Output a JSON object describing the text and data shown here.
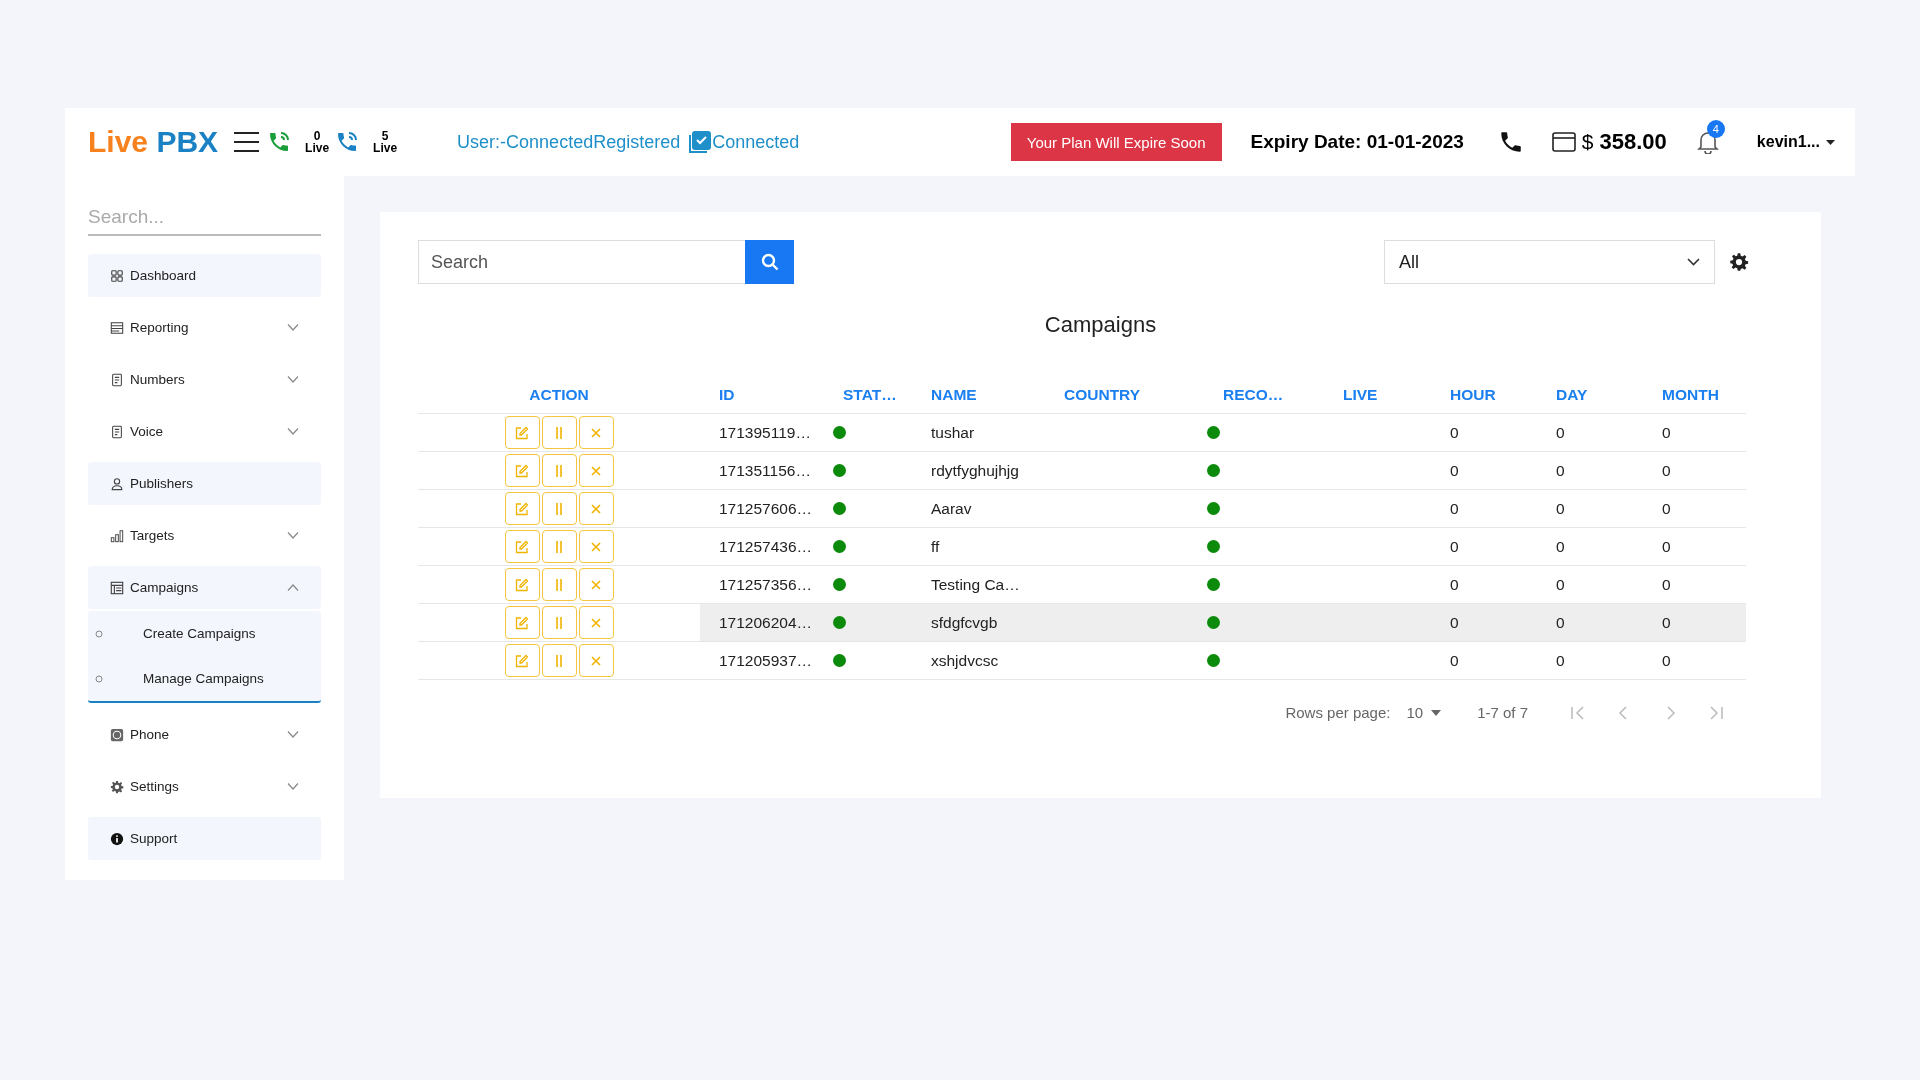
{
  "header": {
    "logo": {
      "part_1": "Live",
      "part_2": "PBX"
    },
    "live_counters": [
      {
        "count": "0",
        "label": "Live",
        "color": "#1a9e3a"
      },
      {
        "count": "5",
        "label": "Live",
        "color": "#1a82c4"
      }
    ],
    "user_status": "User:-ConnectedRegistered",
    "connection": {
      "checked": true,
      "label": "Connected"
    },
    "plan_alert": "Your Plan Will Expire Soon",
    "expiry": "Expiry Date: 01-01-2023",
    "balance": {
      "currency": "$",
      "amount": "358.00"
    },
    "notifications": "4",
    "user": "kevin1..."
  },
  "sidebar": {
    "search": {
      "placeholder": "Search..."
    },
    "items": [
      {
        "label": "Dashboard",
        "kind": "link"
      },
      {
        "label": "Reporting",
        "kind": "group",
        "expanded": false
      },
      {
        "label": "Numbers",
        "kind": "group",
        "expanded": false
      },
      {
        "label": "Voice",
        "kind": "group",
        "expanded": false
      },
      {
        "label": "Publishers",
        "kind": "link"
      },
      {
        "label": "Targets",
        "kind": "group",
        "expanded": false
      },
      {
        "label": "Campaigns",
        "kind": "group",
        "expanded": true,
        "children": [
          {
            "label": "Create Campaigns"
          },
          {
            "label": "Manage Campaigns"
          }
        ]
      },
      {
        "label": "Phone",
        "kind": "group",
        "expanded": false
      },
      {
        "label": "Settings",
        "kind": "group",
        "expanded": false
      },
      {
        "label": "Support",
        "kind": "link"
      }
    ]
  },
  "main": {
    "search": {
      "placeholder": "Search"
    },
    "filter": "All",
    "title": "Campaigns",
    "table": {
      "columns": [
        "ACTION",
        "ID",
        "STAT…",
        "NAME",
        "COUNTRY",
        "RECO…",
        "LIVE",
        "HOUR",
        "DAY",
        "MONTH"
      ],
      "rows": [
        {
          "id": "171395119…",
          "status": {
            "color": "#0b8a0b"
          },
          "name": "tushar",
          "recording": {
            "color": "#0b8a0b"
          },
          "hour": "0",
          "day": "0",
          "month": "0",
          "selected": false
        },
        {
          "id": "171351156…",
          "status": {
            "color": "#0b8a0b"
          },
          "name": "rdytfyghujhjg",
          "recording": {
            "color": "#0b8a0b"
          },
          "hour": "0",
          "day": "0",
          "month": "0",
          "selected": false
        },
        {
          "id": "171257606…",
          "status": {
            "color": "#0b8a0b"
          },
          "name": "Aarav",
          "recording": {
            "color": "#0b8a0b"
          },
          "hour": "0",
          "day": "0",
          "month": "0",
          "selected": false
        },
        {
          "id": "171257436…",
          "status": {
            "color": "#0b8a0b"
          },
          "name": "ff",
          "recording": {
            "color": "#0b8a0b"
          },
          "hour": "0",
          "day": "0",
          "month": "0",
          "selected": false
        },
        {
          "id": "171257356…",
          "status": {
            "color": "#0b8a0b"
          },
          "name": "Testing Ca…",
          "recording": {
            "color": "#0b8a0b"
          },
          "hour": "0",
          "day": "0",
          "month": "0",
          "selected": false
        },
        {
          "id": "171206204…",
          "status": {
            "color": "#0b8a0b"
          },
          "name": "sfdgfcvgb",
          "recording": {
            "color": "#0b8a0b"
          },
          "hour": "0",
          "day": "0",
          "month": "0",
          "selected": true
        },
        {
          "id": "171205937…",
          "status": {
            "color": "#0b8a0b"
          },
          "name": "xshjdvcsc",
          "recording": {
            "color": "#0b8a0b"
          },
          "hour": "0",
          "day": "0",
          "month": "0",
          "selected": false
        }
      ]
    },
    "pagination": {
      "rows_label": "Rows per page:",
      "rows_value": "10",
      "range": "1-7 of 7"
    }
  }
}
